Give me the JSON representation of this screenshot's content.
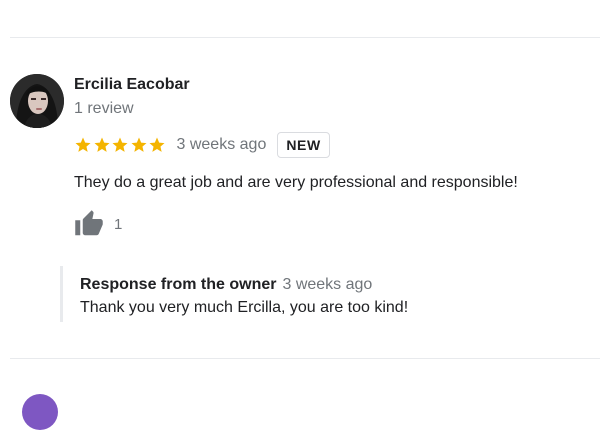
{
  "review": {
    "reviewer_name": "Ercilia Eacobar",
    "reviewer_meta": "1 review",
    "rating": 5,
    "time": "3 weeks ago",
    "badge": "NEW",
    "text": "They do a great job and are very professional and responsible!",
    "like_count": "1"
  },
  "owner_response": {
    "title": "Response from the owner",
    "time": "3 weeks ago",
    "text": "Thank you very much Ercilla, you are too kind!"
  },
  "colors": {
    "star": "#f4b400",
    "secondary_text": "#70757a",
    "divider": "#e8eaed"
  },
  "icons": [
    "star-icon",
    "thumbs-up-icon"
  ]
}
